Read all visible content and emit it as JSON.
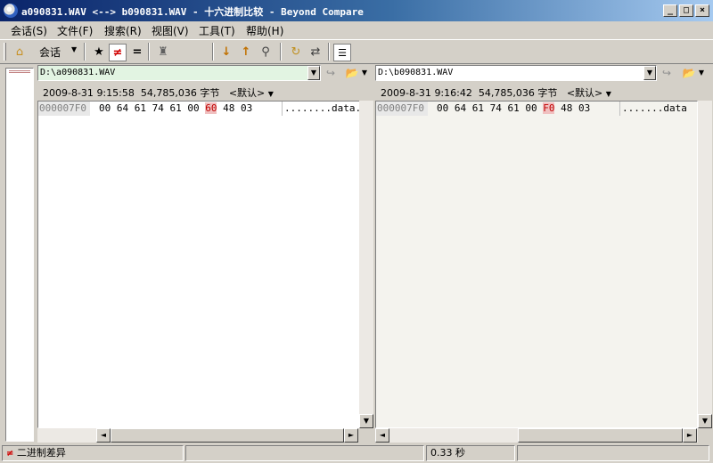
{
  "window": {
    "title": "a090831.WAV <--> b090831.WAV - 十六进制比较 - Beyond Compare",
    "buttons": [
      "_",
      "□",
      "×"
    ]
  },
  "menu": [
    "会话(S)",
    "文件(F)",
    "搜索(R)",
    "视图(V)",
    "工具(T)",
    "帮助(H)"
  ],
  "toolbar": {
    "sessions_label": "会话",
    "icons": [
      "home-icon",
      "sessions-dropdown-icon",
      "show-all-icon",
      "show-differences-icon",
      "show-same-icon",
      "rules-icon",
      "next-difference-icon",
      "previous-difference-icon",
      "find-icon",
      "refresh-icon",
      "swap-icon",
      "options-icon"
    ]
  },
  "left": {
    "path": "D:\\a090831.WAV",
    "date": "2009-8-31",
    "time": "9:15:58",
    "size": "54,785,036 字节",
    "format": "<默认>",
    "row": {
      "addr": "000007F0",
      "before": "00 64 61 74 61 00 ",
      "diff": "60",
      "after": " 48 03",
      "ascii": "........data."
    }
  },
  "right": {
    "path": "D:\\b090831.WAV",
    "date": "2009-8-31",
    "time": "9:16:42",
    "size": "54,785,036 字节",
    "format": "<默认>",
    "row": {
      "addr": "000007F0",
      "before": "00 64 61 74 61 00 ",
      "diff": "F0",
      "after": " 48 03",
      "ascii": ".......data"
    }
  },
  "status": {
    "mode": "二进制差异",
    "time": "0.33 秒"
  },
  "colors": {
    "title_start": "#0a246a",
    "title_end": "#a6caf0",
    "diff_bg": "#f0c0c0",
    "diff_fg": "#c00000",
    "left_path_bg": "#e2f4e2"
  }
}
